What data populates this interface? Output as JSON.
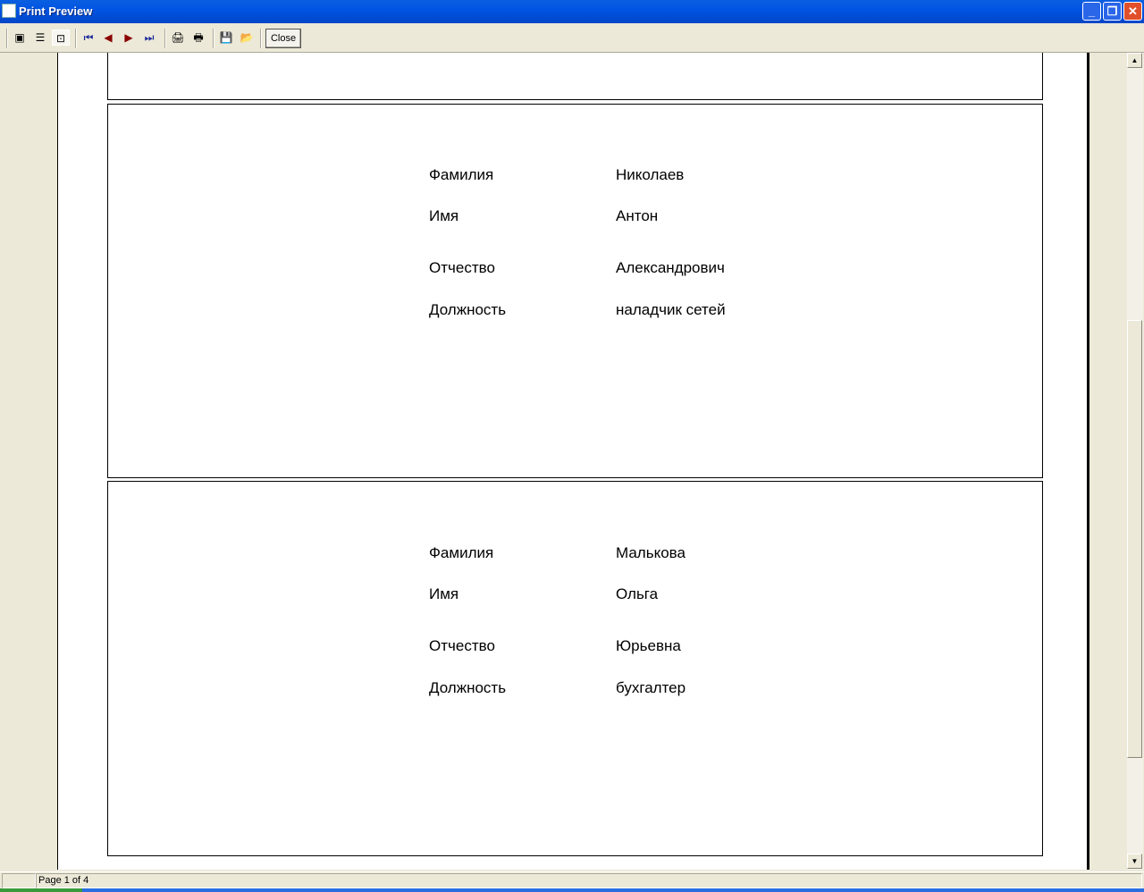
{
  "window": {
    "title": "Print Preview"
  },
  "toolbar": {
    "close_label": "Close",
    "buttons": [
      "one-page-icon",
      "multi-page-icon",
      "zoom-fit-icon",
      "first-page-icon",
      "prev-page-icon",
      "next-page-icon",
      "last-page-icon",
      "print-setup-icon",
      "print-icon",
      "save-icon",
      "open-icon"
    ]
  },
  "labels": {
    "surname": "Фамилия",
    "name": "Имя",
    "patronymic": "Отчество",
    "position": "Должность"
  },
  "records": [
    {
      "surname": "Николаев",
      "name": "Антон",
      "patronymic": "Александрович",
      "position": "наладчик сетей"
    },
    {
      "surname": "Малькова",
      "name": "Ольга",
      "patronymic": "Юрьевна",
      "position": "бухгалтер"
    }
  ],
  "status": {
    "page": "Page 1 of 4"
  }
}
